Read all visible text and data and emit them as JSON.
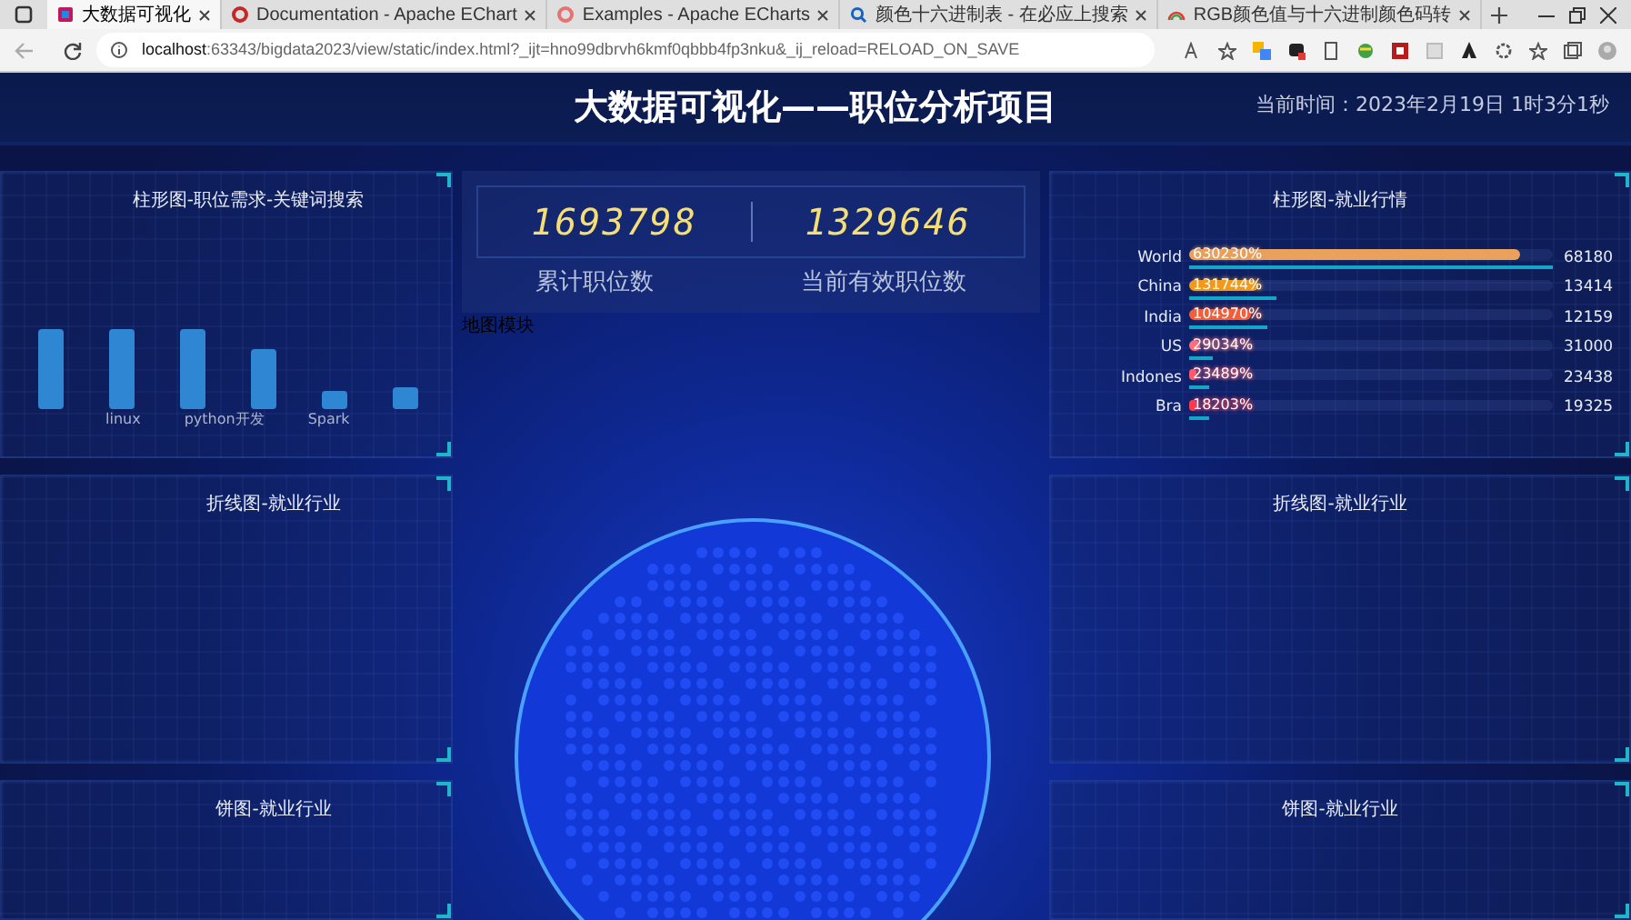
{
  "browser": {
    "tabs": [
      {
        "title": "大数据可视化",
        "selected": true,
        "kind": "app"
      },
      {
        "title": "Documentation - Apache EChart",
        "selected": false,
        "kind": "ring"
      },
      {
        "title": "Examples - Apache ECharts",
        "selected": false,
        "kind": "ring"
      },
      {
        "title": "颜色十六进制表 - 在必应上搜索",
        "selected": false,
        "kind": "search"
      },
      {
        "title": "RGB颜色值与十六进制颜色码转",
        "selected": false,
        "kind": "rainbow"
      }
    ],
    "url_host": "localhost",
    "url_rest": ":63343/bigdata2023/view/static/index.html?_ijt=hno99dbrvh6kmf0qbbb4fp3nku&_ij_reload=RELOAD_ON_SAVE"
  },
  "header": {
    "title": "大数据可视化——职位分析项目",
    "time": "当前时间：2023年2月19日 1时3分1秒"
  },
  "left_panels": [
    {
      "title": "柱形图-职位需求-关键词搜索",
      "kind": "bars",
      "axis_labels": [
        "linux",
        "python开发",
        "Spark"
      ]
    },
    {
      "title": "折线图-就业行业",
      "kind": "empty"
    },
    {
      "title": "饼图-就业行业",
      "kind": "empty"
    }
  ],
  "counters": [
    {
      "number": "1693798",
      "label": "累计职位数"
    },
    {
      "number": "1329646",
      "label": "当前有效职位数"
    }
  ],
  "map_label": "地图模块",
  "right_panels": [
    {
      "title": "柱形图-就业行情",
      "kind": "hbars",
      "rows": [
        {
          "category": "World",
          "percent": "630230%",
          "value": "68180",
          "level": 0.91,
          "color": "#e9a15c"
        },
        {
          "category": "China",
          "percent": "131744%",
          "value": "13414",
          "level": 0.19,
          "color": "#f29a1c"
        },
        {
          "category": "India",
          "percent": "104970%",
          "value": "12159",
          "level": 0.17,
          "color": "#f2603c"
        },
        {
          "category": "US",
          "percent": "29034%",
          "value": "31000",
          "level": 0.03,
          "color": "#ff6f7a"
        },
        {
          "category": "Indones",
          "percent": "23489%",
          "value": "23438",
          "level": 0.02,
          "color": "#ff5a6a"
        },
        {
          "category": "Bra",
          "percent": "18203%",
          "value": "19325",
          "level": 0.02,
          "color": "#ff3b4e"
        }
      ]
    },
    {
      "title": "折线图-就业行业",
      "kind": "empty"
    },
    {
      "title": "饼图-就业行业",
      "kind": "empty"
    }
  ]
}
